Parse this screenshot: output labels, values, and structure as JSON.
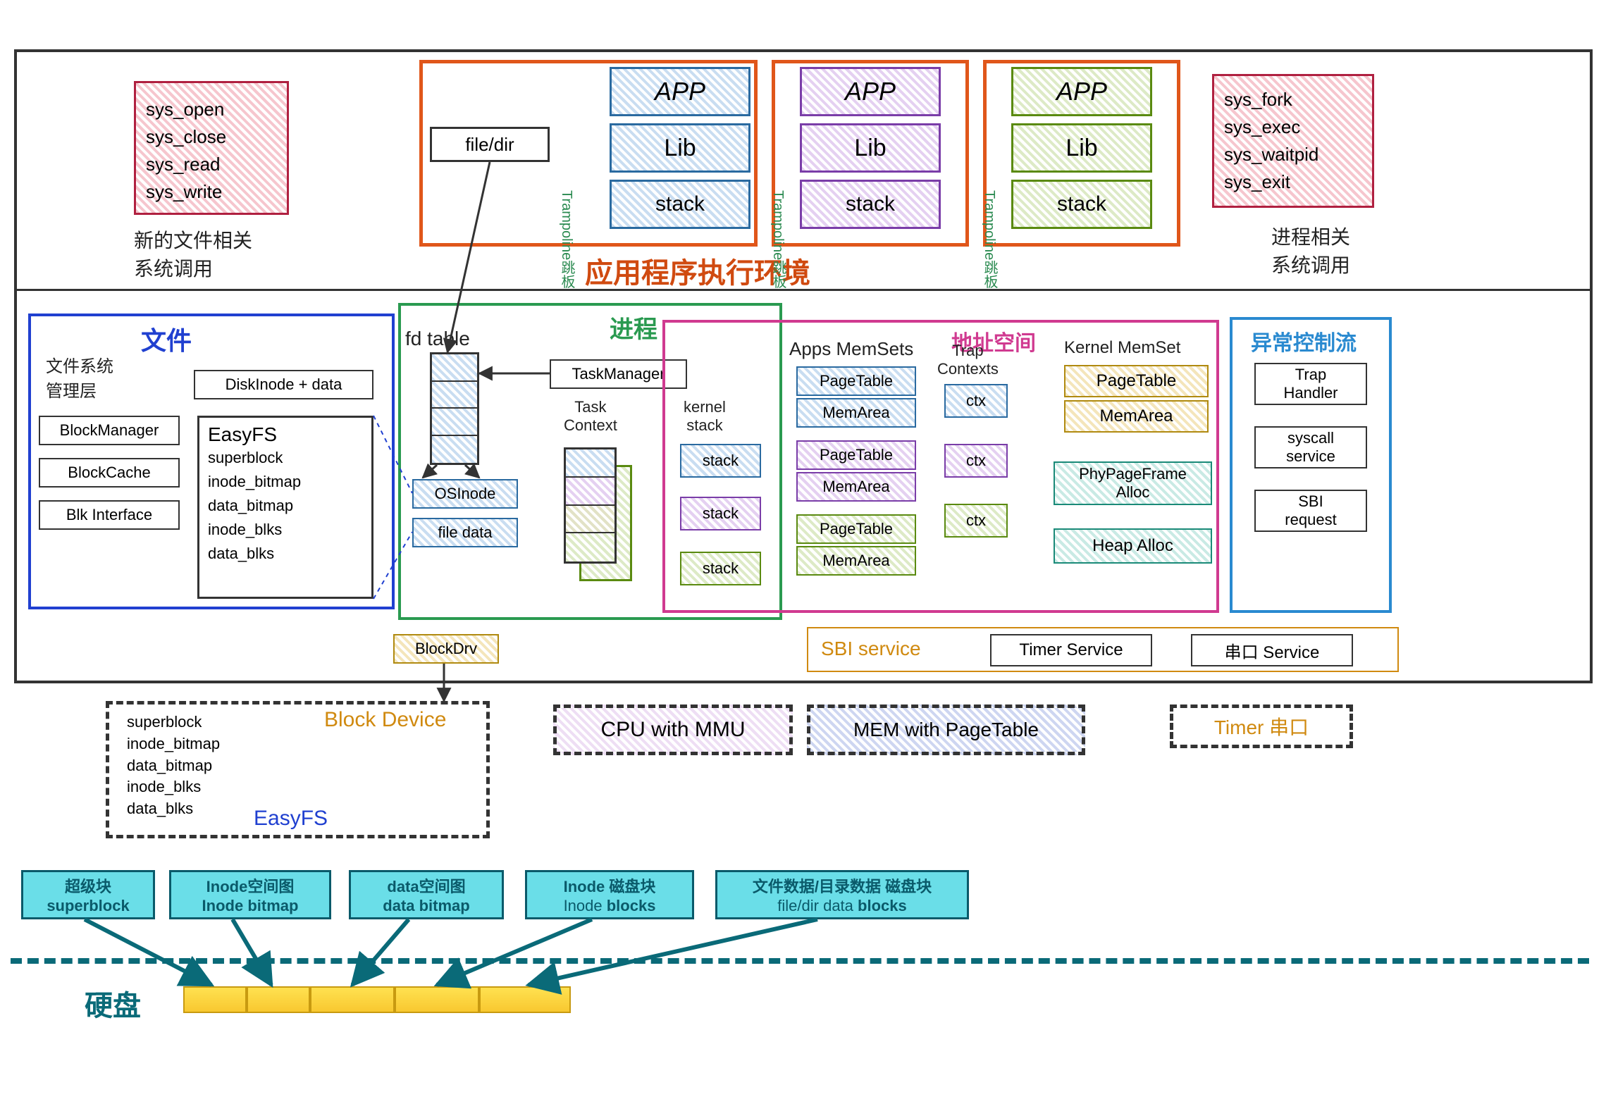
{
  "outer_sections": {
    "new_fs_syscalls": {
      "lines": [
        "sys_open",
        "sys_close",
        "sys_read",
        "sys_write"
      ],
      "caption": "新的文件相关\n系统调用"
    },
    "proc_syscalls": {
      "lines": [
        "sys_fork",
        "sys_exec",
        "sys_waitpid",
        "sys_exit"
      ],
      "caption": "进程相关\n系统调用"
    },
    "app_env_title": "应用程序执行环境",
    "app_stacks": {
      "app": "APP",
      "lib": "Lib",
      "stack": "stack"
    },
    "file_dir": "file/dir",
    "trampoline": "Trampoline跳板"
  },
  "fs": {
    "title": "文件",
    "mgmt_layer": "文件系统\n管理层",
    "diskinode": "DiskInode + data",
    "block_manager": "BlockManager",
    "block_cache": "BlockCache",
    "blk_interface": "Blk Interface",
    "easyfs_title": "EasyFS",
    "easyfs_items": [
      "superblock",
      "inode_bitmap",
      "data_bitmap",
      "inode_blks",
      "data_blks"
    ],
    "fd_table": "fd table",
    "osinode": "OSInode",
    "file_data": "file data",
    "block_drv": "BlockDrv"
  },
  "process": {
    "title": "进程",
    "task_manager": "TaskManager",
    "task_context": "Task\nContext",
    "kernel_stack": "kernel\nstack",
    "stack": "stack"
  },
  "memory": {
    "title": "地址空间",
    "apps_memsets": "Apps MemSets",
    "pagetable": "PageTable",
    "memarea": "MemArea",
    "trap_contexts": "Trap\nContexts",
    "ctx": "ctx",
    "kernel_memset": "Kernel MemSet",
    "phy_alloc": "PhyPageFrame\nAlloc",
    "heap_alloc": "Heap Alloc"
  },
  "exception": {
    "title": "异常控制流",
    "trap_handler": "Trap\nHandler",
    "syscall_service": "syscall\nservice",
    "sbi_request": "SBI\nrequest"
  },
  "sbi": {
    "label": "SBI service",
    "timer": "Timer Service",
    "uart": "串口 Service"
  },
  "hw": {
    "block_device": "Block Device",
    "easyfs": "EasyFS",
    "items": [
      "superblock",
      "inode_bitmap",
      "data_bitmap",
      "inode_blks",
      "data_blks"
    ],
    "cpu_mmu": "CPU with MMU",
    "mem_pt": "MEM with PageTable",
    "timer_uart": "Timer 串口"
  },
  "disk": {
    "label": "硬盘",
    "blocks": [
      {
        "zh": "超级块",
        "en": "superblock"
      },
      {
        "zh": "Inode空间图",
        "en": "Inode bitmap"
      },
      {
        "zh": "data空间图",
        "en": "data bitmap"
      },
      {
        "zh": "Inode 磁盘块",
        "en": "Inode blocks"
      },
      {
        "zh": "文件数据/目录数据 磁盘块",
        "en": "file/dir data blocks"
      }
    ]
  }
}
